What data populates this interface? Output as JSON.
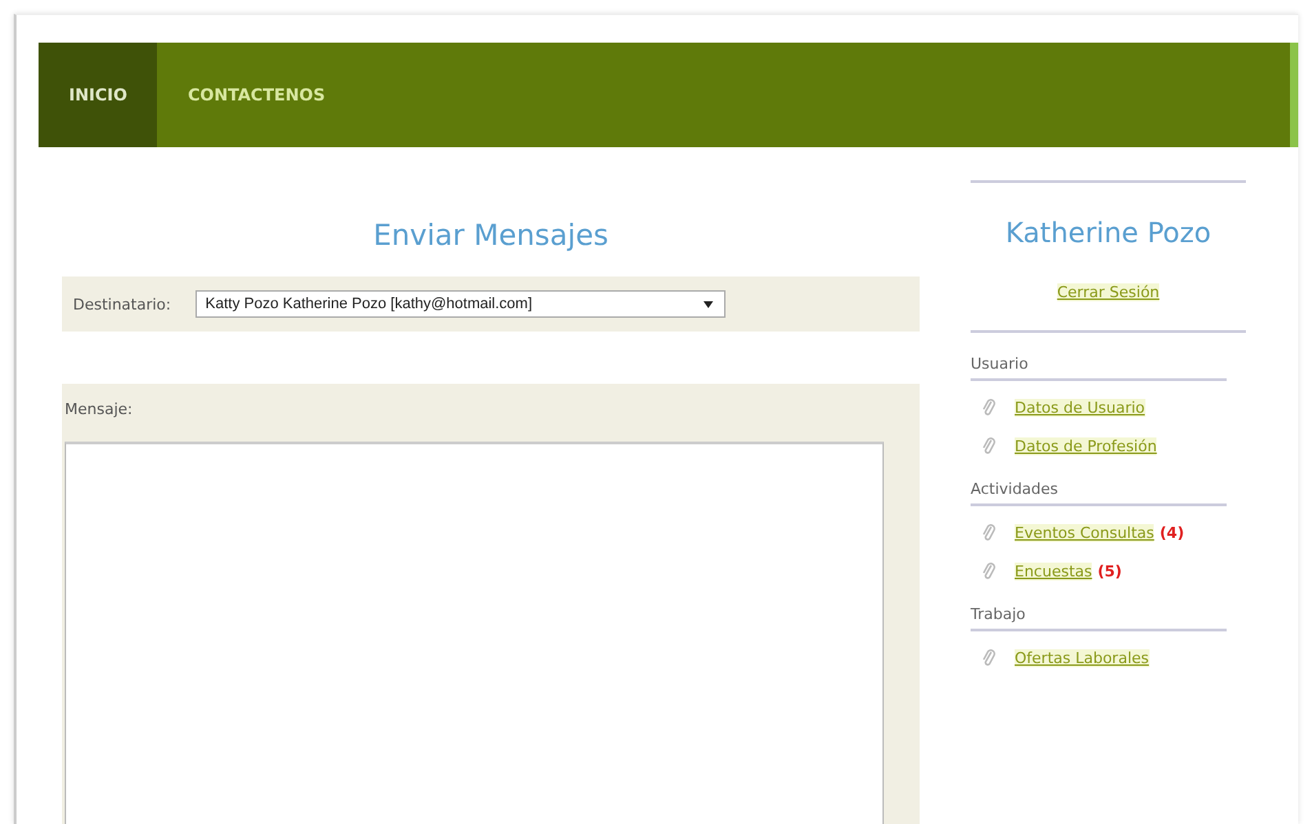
{
  "nav": [
    {
      "label": "INICIO",
      "selected": true
    },
    {
      "label": "CONTACTENOS",
      "selected": false
    }
  ],
  "main": {
    "title": "Enviar Mensajes",
    "recipient_label": "Destinatario:",
    "recipient_value": "Katty Pozo Katherine Pozo [kathy@hotmail.com]",
    "message_label": "Mensaje:"
  },
  "sidebar": {
    "user_name": "Katherine Pozo",
    "logout": "Cerrar Sesión",
    "sections": [
      {
        "title": "Usuario",
        "links": [
          {
            "label": "Datos de Usuario"
          },
          {
            "label": "Datos de Profesión"
          }
        ]
      },
      {
        "title": "Actividades",
        "links": [
          {
            "label": "Eventos Consultas",
            "count": "(4)"
          },
          {
            "label": "Encuestas",
            "count": "(5)"
          }
        ]
      },
      {
        "title": "Trabajo",
        "links": [
          {
            "label": "Ofertas Laborales"
          }
        ]
      }
    ]
  }
}
